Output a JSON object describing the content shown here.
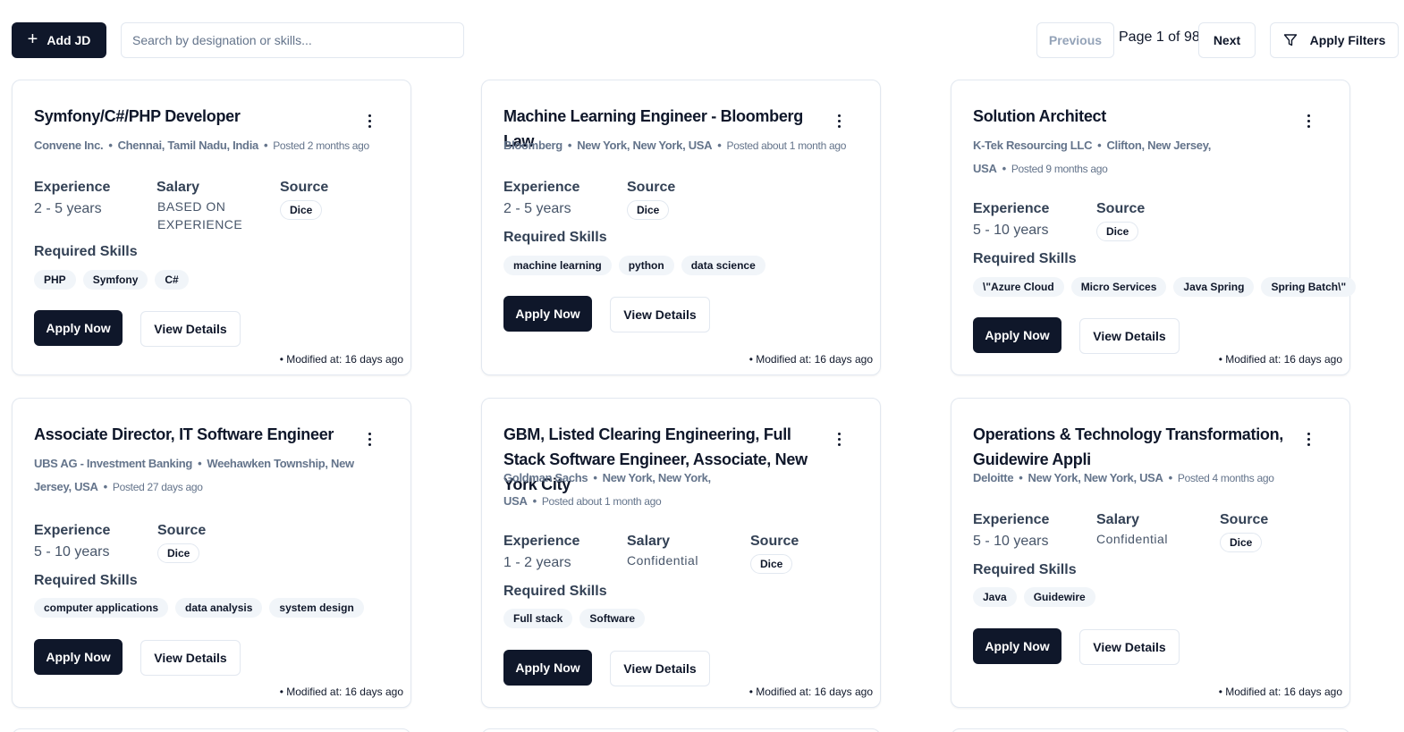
{
  "toolbar": {
    "add_jd_label": "Add JD",
    "search_placeholder": "Search by designation or skills...",
    "search_value": "",
    "previous_label": "Previous",
    "page_info": "Page 1 of 98",
    "next_label": "Next",
    "filters_label": "Apply Filters"
  },
  "labels": {
    "experience": "Experience",
    "salary": "Salary",
    "source": "Source",
    "required_skills": "Required Skills",
    "apply_now": "Apply Now",
    "view_details": "View Details",
    "dot": "•"
  },
  "jobs": [
    {
      "title": "Symfony/C#/PHP Developer",
      "company": "Convene Inc.",
      "location": "Chennai, Tamil Nadu, India",
      "posted": "Posted 2 months ago",
      "experience": "2 - 5 years",
      "salary": "BASED ON EXPERIENCE",
      "source": "Dice",
      "skills": [
        "PHP",
        "Symfony",
        "C#"
      ],
      "modified": "• Modified at: 16 days ago"
    },
    {
      "title": "Machine Learning Engineer - Bloomberg Law",
      "company": "Bloomberg",
      "location": "New York, New York, USA",
      "posted": "Posted about 1 month ago",
      "experience": "2 - 5 years",
      "salary": "",
      "source": "Dice",
      "skills": [
        "machine learning",
        "python",
        "data science"
      ],
      "modified": "• Modified at: 16 days ago"
    },
    {
      "title": "Solution Architect",
      "company": "K-Tek Resourcing LLC",
      "location": "Clifton, New Jersey, USA",
      "posted": "Posted 9 months ago",
      "experience": "5 - 10 years",
      "salary": "",
      "source": "Dice",
      "skills": [
        "\\\"Azure Cloud",
        "Micro Services",
        "Java Spring",
        "Spring Batch\\\""
      ],
      "modified": "• Modified at: 16 days ago"
    },
    {
      "title": "Associate Director, IT Software Engineer",
      "company": "UBS AG - Investment Banking",
      "location": "Weehawken Township, New Jersey, USA",
      "posted": "Posted 27 days ago",
      "experience": "5 - 10 years",
      "salary": "",
      "source": "Dice",
      "skills": [
        "computer applications",
        "data analysis",
        "system design"
      ],
      "modified": "• Modified at: 16 days ago"
    },
    {
      "title": "GBM, Listed Clearing Engineering, Full Stack Software Engineer, Associate, New York City",
      "company": "Goldman Sachs",
      "location": "New York, New York, USA",
      "posted": "Posted about 1 month ago",
      "experience": "1 - 2 years",
      "salary": "Confidential",
      "source": "Dice",
      "skills": [
        "Full stack",
        "Software"
      ],
      "modified": "• Modified at: 16 days ago"
    },
    {
      "title": "Operations & Technology Transformation, Guidewire Appli",
      "company": "Deloitte",
      "location": "New York, New York, USA",
      "posted": "Posted 4 months ago",
      "experience": "5 - 10 years",
      "salary": "Confidential",
      "source": "Dice",
      "skills": [
        "Java",
        "Guidewire"
      ],
      "modified": "• Modified at: 16 days ago"
    }
  ]
}
